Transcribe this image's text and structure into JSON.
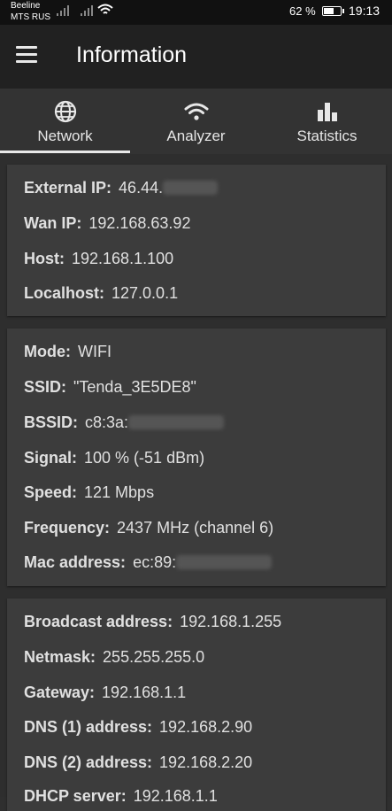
{
  "status_bar": {
    "carrier_1": "Beeline",
    "carrier_2": "MTS RUS",
    "battery": "62 %",
    "battery_level": 0.62,
    "time": "19:13"
  },
  "app_bar": {
    "title": "Information"
  },
  "tabs": [
    {
      "label": "Network",
      "icon": "globe-icon",
      "active": true
    },
    {
      "label": "Analyzer",
      "icon": "wifi-icon",
      "active": false
    },
    {
      "label": "Statistics",
      "icon": "bar-chart-icon",
      "active": false
    }
  ],
  "cards": {
    "ip": [
      {
        "label": "External IP:",
        "value": "46.44.",
        "blurred": true
      },
      {
        "label": "Wan IP:",
        "value": "192.168.63.92"
      },
      {
        "label": "Host:",
        "value": "192.168.1.100"
      },
      {
        "label": "Localhost:",
        "value": "127.0.0.1"
      }
    ],
    "wifi": [
      {
        "label": "Mode:",
        "value": "WIFI"
      },
      {
        "label": "SSID:",
        "value": "\"Tenda_3E5DE8\""
      },
      {
        "label": "BSSID:",
        "value": "c8:3a:",
        "blurred": true
      },
      {
        "label": "Signal:",
        "value": "100 % (-51 dBm)"
      },
      {
        "label": "Speed:",
        "value": "121 Mbps"
      },
      {
        "label": "Frequency:",
        "value": "2437 MHz (channel 6)"
      },
      {
        "label": "Mac address:",
        "value": "ec:89:",
        "blurred": true
      }
    ],
    "network": [
      {
        "label": "Broadcast address:",
        "value": "192.168.1.255"
      },
      {
        "label": "Netmask:",
        "value": "255.255.255.0"
      },
      {
        "label": "Gateway:",
        "value": "192.168.1.1"
      },
      {
        "label": "DNS (1) address:",
        "value": "192.168.2.90"
      },
      {
        "label": "DNS (2) address:",
        "value": "192.168.2.20"
      },
      {
        "label": "DHCP server:",
        "value": "192.168.1.1"
      }
    ]
  },
  "colors": {
    "background": "#2f2f2f",
    "card": "#3c3c3c",
    "app_bar": "#212121",
    "status_bar": "#111111"
  }
}
